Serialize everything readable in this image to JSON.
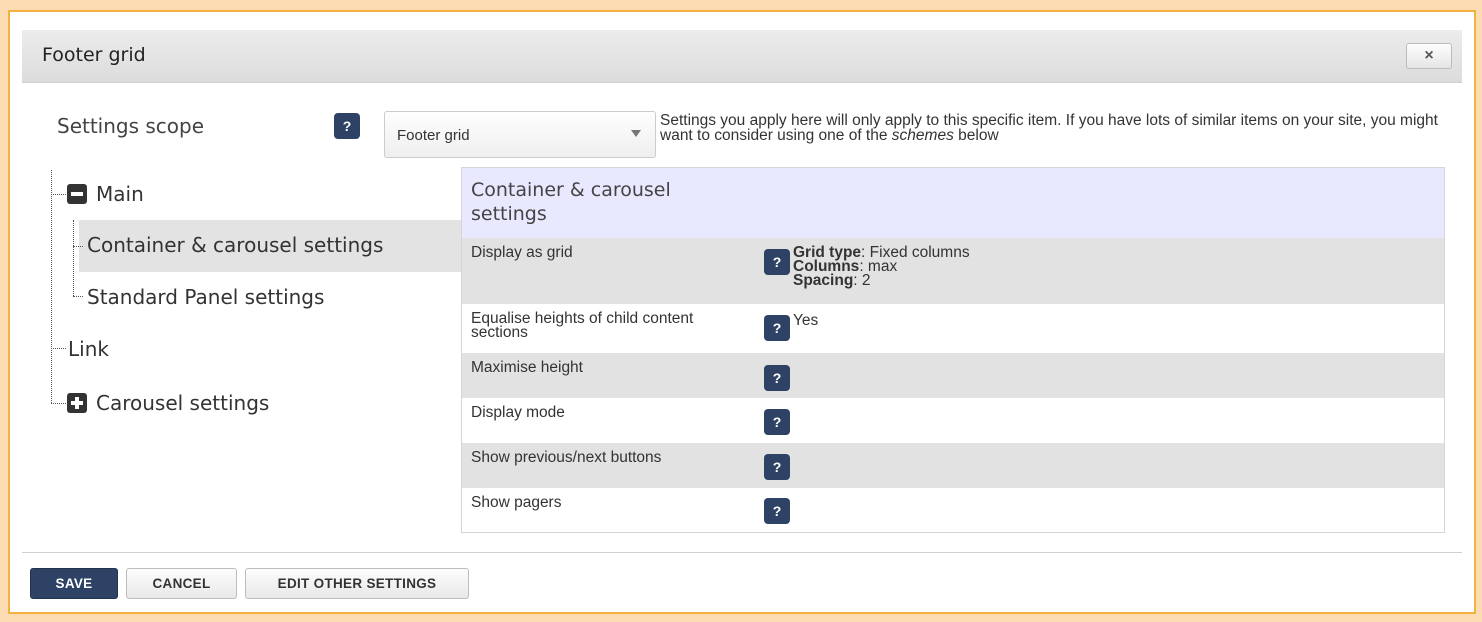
{
  "dialog": {
    "title": "Footer grid",
    "close_icon": "×"
  },
  "scope": {
    "label": "Settings scope",
    "help": "?",
    "selected": "Footer grid",
    "note_part1": "Settings you apply here will only apply to this specific item. If you have lots of similar items on your site, you might want to consider using one of the ",
    "note_em": "schemes",
    "note_part2": " below"
  },
  "tree": {
    "main": "Main",
    "container": "Container & carousel settings",
    "standard": "Standard Panel settings",
    "link": "Link",
    "carousel": "Carousel settings"
  },
  "panel": {
    "title": "Container & carousel settings",
    "rows": [
      {
        "label": "Display as grid",
        "help": "?",
        "values": [
          {
            "key": "Grid type",
            "val": ": Fixed columns"
          },
          {
            "key": "Columns",
            "val": ": max"
          },
          {
            "key": "Spacing",
            "val": ": 2"
          }
        ]
      },
      {
        "label": "Equalise heights of child content sections",
        "help": "?",
        "value": "Yes"
      },
      {
        "label": "Maximise height",
        "help": "?",
        "value": ""
      },
      {
        "label": "Display mode",
        "help": "?",
        "value": ""
      },
      {
        "label": "Show previous/next buttons",
        "help": "?",
        "value": ""
      },
      {
        "label": "Show pagers",
        "help": "?",
        "value": ""
      }
    ]
  },
  "buttons": {
    "save": "SAVE",
    "cancel": "CANCEL",
    "edit_other": "EDIT OTHER SETTINGS"
  },
  "colors": {
    "accent": "#2e4266",
    "frame_border": "#f5b042",
    "header_bg": "#e8e8ff"
  }
}
